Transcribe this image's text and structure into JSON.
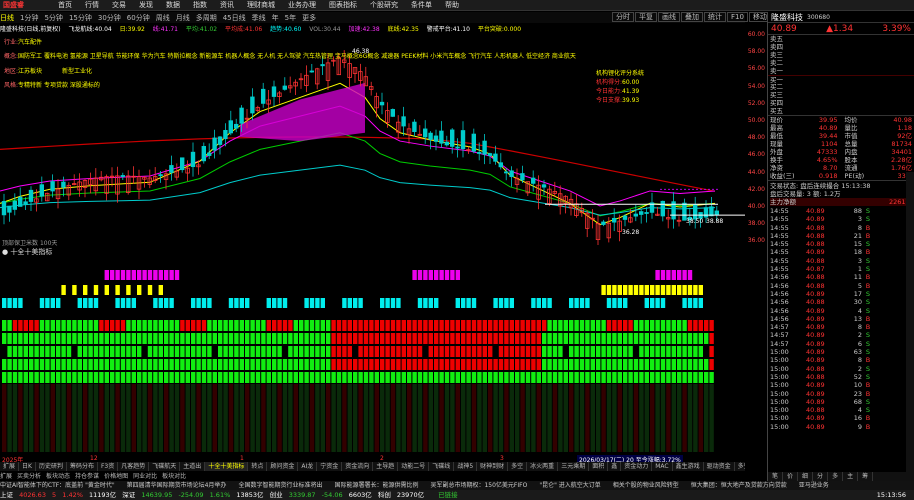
{
  "app": {
    "name": "国盛睿",
    "menu": [
      "首页",
      "行情",
      "交易",
      "发现",
      "数据",
      "指数",
      "资讯",
      "理财商城",
      "业务办理",
      "图表指标",
      "个股研究",
      "条件单",
      "帮助"
    ]
  },
  "period_bar": {
    "items": [
      "日线",
      "1分钟",
      "5分钟",
      "15分钟",
      "30分钟",
      "60分钟",
      "周线",
      "月线",
      "多周期",
      "45日线",
      "季线",
      "年",
      "5年",
      "更多"
    ],
    "active": "日线"
  },
  "toolbar": [
    "分时",
    "平复",
    "画线",
    "叠加",
    "统计",
    "F10",
    "移动",
    "隐藏"
  ],
  "info": {
    "title": "隆盛科技(日线,前复权)",
    "ma1": "飞龙航线:40.04",
    "ma2": "日:39.92",
    "ma3": "线:41.71",
    "ma4": "平均:41.02",
    "ma5": "平均成:41.06",
    "ma6": "趋势:40.60",
    "vol": "VOL:30.44",
    "sig": "加速:42.38",
    "sig2": "底线:42.35",
    "sig3": "警戒平台:41.10",
    "sig4": "平台突破:0.000"
  },
  "tags": {
    "industry_label": "行业:",
    "industry": "汽车配件",
    "concept_label": "概念:",
    "concept": "国防军工 覆料电池 氢能源 卫星导航 节能环保 华为汽车 特斯拉概念 新能源车 机器人概念 无人机 无人驾驶 汽车热管理 宝马概念6G概念 减速器 PEEK材料 小米汽车概念 飞行汽车 人形机器人 低空经济 商业航天",
    "area_label": "地区:",
    "area": "江苏板块",
    "area2": "新型工业化",
    "style_label": "风格:",
    "style": "专精特新 专项贷款 深股通标的"
  },
  "annotation": {
    "title": "机构锂化评分系统",
    "l1": "机构得分:",
    "v1": "60.00",
    "l2": "今日能力:",
    "v2": "41.39",
    "l3": "今日支撑:",
    "v3": "39.93"
  },
  "chart_labels": {
    "low": "36.28",
    "lowR": "38.50",
    "lowR2": "38.88",
    "high": "46.38"
  },
  "price_axis": [
    "60.00",
    "58.00",
    "56.00",
    "54.00",
    "52.00",
    "50.00",
    "48.00",
    "46.00",
    "44.00",
    "42.00",
    "40.00",
    "38.00",
    "36.00"
  ],
  "indicator": {
    "title": "十全十美指标",
    "vlabel": "顶部保卫米数",
    "vsub": "100天"
  },
  "date_labels": {
    "year": "2025年",
    "d1": "12",
    "d2": "1",
    "d3": "2",
    "d4": "3",
    "tip": "2026/03/17(二) 20 至今涨幅:3.72%"
  },
  "bottom_tabs": [
    "扩展",
    "日K",
    "历史研判",
    "筹码分布",
    "F3资",
    "凡客趋势",
    "飞碟航天",
    "主道出",
    "十全十美指标",
    "转点",
    "顾问资金",
    "AI龙",
    "宁资金",
    "资金流向",
    "主导趋",
    "动能二号",
    "飞碟线",
    "战神5",
    "财神到财",
    "多空",
    "冰火两重",
    "三元乘期",
    "面积",
    "鑫",
    "资金动力",
    "MAC",
    "鑫生游戏",
    "驱动资金",
    "多空庄",
    "炒股量",
    "三日资盘",
    "指标6"
  ],
  "bottom_tabs2": [
    "扩展",
    "买卖分析",
    "板块动态",
    "持仓参谋",
    "价格地图",
    "同业对比",
    "板块对比"
  ],
  "news": [
    "中证AI智能体下的CTF：底盖前 \"黄金时代\"",
    "第四届清华国际期货市场论坛4月举办",
    "全国数字智能期货行业标准将出",
    "国际能源署署长：能源供需比例",
    "吴军副总市场期权：150亿美元FIFO",
    "\"昆仑\" 进入航空大订单",
    "相关个股的物业风险转型",
    "恒大集团：恒大地产及贷款方向贷款",
    "亚马逊业务"
  ],
  "status": {
    "m1": "上证",
    "v1": "4026.63",
    "c1": "5",
    "v1b": "1.42%",
    "a1": "11193亿",
    "m2": "深证",
    "v2": "14639.95",
    "c2": "-254.09",
    "v2b": "1.61%",
    "a2": "13853亿",
    "m3": "创业",
    "v3": "3339.87",
    "c3": "-54.06",
    "a3": "6603亿",
    "m4": "科创",
    "v4": "23970亿",
    "lbl": "已链接",
    "time": "15:13:56"
  },
  "stock": {
    "name": "隆盛科技",
    "code": "300680",
    "price": "40.89",
    "change": "▲1.34",
    "pct": "3.39%"
  },
  "orderbook": [
    {
      "lvl": "卖五",
      "p": "",
      "v": ""
    },
    {
      "lvl": "卖四",
      "p": "",
      "v": ""
    },
    {
      "lvl": "卖三",
      "p": "",
      "v": ""
    },
    {
      "lvl": "卖二",
      "p": "",
      "v": ""
    },
    {
      "lvl": "卖一",
      "p": "",
      "v": ""
    },
    {
      "lvl": "买一",
      "p": "",
      "v": ""
    },
    {
      "lvl": "买二",
      "p": "",
      "v": ""
    },
    {
      "lvl": "买三",
      "p": "",
      "v": ""
    },
    {
      "lvl": "买四",
      "p": "",
      "v": ""
    },
    {
      "lvl": "买五",
      "p": "",
      "v": ""
    }
  ],
  "quote": [
    [
      "现价",
      "39.95",
      "均价",
      "40.98"
    ],
    [
      "最高",
      "40.89",
      "量比",
      "1.18"
    ],
    [
      "最低",
      "39.44",
      "市值",
      "92亿"
    ],
    [
      "现量",
      "1104",
      "总量",
      "81734"
    ],
    [
      "外盘",
      "47333",
      "内盘",
      "34401"
    ],
    [
      "换手",
      "4.65%",
      "股本",
      "2.28亿"
    ],
    [
      "净资",
      "8.70",
      "流通",
      "1.76亿"
    ],
    [
      "收益(三)",
      "0.918",
      "PE(动)",
      "33.2"
    ]
  ],
  "state": {
    "l1": "交易状态: 盘后连续撮合 15:13:38",
    "l2": "盘后交易量: 3 额: 1.2万",
    "l3": "主力净额",
    "v3": "2261万"
  },
  "trades": [
    [
      "14:55",
      "40.89",
      "88",
      "S"
    ],
    [
      "14:55",
      "40.89",
      "3",
      "S"
    ],
    [
      "14:55",
      "40.88",
      "8",
      "B"
    ],
    [
      "14:55",
      "40.88",
      "21",
      "B"
    ],
    [
      "14:55",
      "40.88",
      "15",
      "S"
    ],
    [
      "14:55",
      "40.89",
      "18",
      "B"
    ],
    [
      "14:55",
      "40.88",
      "3",
      "S"
    ],
    [
      "14:55",
      "40.87",
      "1",
      "S"
    ],
    [
      "14:56",
      "40.88",
      "11",
      "B"
    ],
    [
      "14:56",
      "40.88",
      "5",
      "B"
    ],
    [
      "14:56",
      "40.89",
      "17",
      "S"
    ],
    [
      "14:56",
      "40.88",
      "30",
      "S"
    ],
    [
      "14:56",
      "40.89",
      "4",
      "S"
    ],
    [
      "14:56",
      "40.89",
      "13",
      "B"
    ],
    [
      "14:57",
      "40.89",
      "8",
      "B"
    ],
    [
      "14:57",
      "40.89",
      "2",
      "S"
    ],
    [
      "14:57",
      "40.89",
      "6",
      "S"
    ],
    [
      "15:00",
      "40.89",
      "63",
      "S"
    ],
    [
      "15:00",
      "40.89",
      "8",
      "B"
    ],
    [
      "15:00",
      "40.88",
      "2",
      "S"
    ],
    [
      "15:00",
      "40.88",
      "52",
      "S"
    ],
    [
      "15:00",
      "40.89",
      "10",
      "B"
    ],
    [
      "15:00",
      "40.89",
      "23",
      "B"
    ],
    [
      "15:00",
      "40.89",
      "68",
      "S"
    ],
    [
      "15:00",
      "40.88",
      "4",
      "S"
    ],
    [
      "15:00",
      "40.89",
      "16",
      "B"
    ],
    [
      "15:00",
      "40.89",
      "9",
      "B"
    ]
  ],
  "right_tabs": [
    "笔",
    "价",
    "细",
    "分",
    "多",
    "主",
    "筹"
  ],
  "colors": {
    "up": "#f33",
    "down": "#0cc",
    "ma_yellow": "#ff0",
    "ma_magenta": "#f0f",
    "ma_green": "#0c0",
    "ma_red": "#c00",
    "ma_cyan": "#0cc"
  }
}
